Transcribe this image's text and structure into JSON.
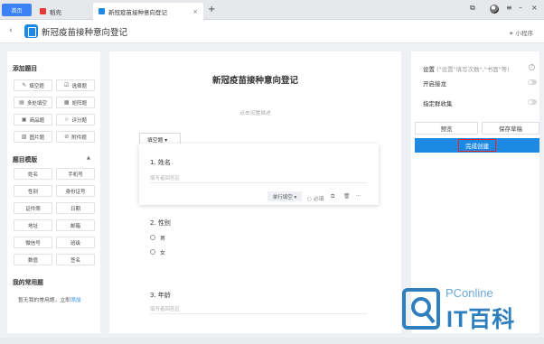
{
  "browser": {
    "tabs": [
      {
        "label": "首页"
      },
      {
        "label": "稻壳"
      },
      {
        "label": "新冠疫苗接种意向登记"
      }
    ]
  },
  "header": {
    "back": "‹",
    "title": "新冠疫苗接种意向登记",
    "mini_program": "小程序"
  },
  "left": {
    "add_title": "添加题目",
    "question_types": [
      {
        "icon": "✎",
        "label": "填空题"
      },
      {
        "icon": "☑",
        "label": "选择题"
      },
      {
        "icon": "▤",
        "label": "多处填空"
      },
      {
        "icon": "▦",
        "label": "矩阵题"
      },
      {
        "icon": "▣",
        "label": "商品题"
      },
      {
        "icon": "☆",
        "label": "评分题"
      },
      {
        "icon": "▨",
        "label": "图片题"
      },
      {
        "icon": "⊘",
        "label": "附件题"
      }
    ],
    "template_title": "题目模版",
    "templates": [
      "姓名",
      "手机号",
      "性别",
      "身份证号",
      "证件照",
      "日期",
      "地址",
      "邮箱",
      "微信号",
      "班级",
      "数值",
      "签名"
    ],
    "common_title": "我的常用题",
    "common_hint": "暂无我的常用题，立即",
    "common_link": "添加"
  },
  "form": {
    "title": "新冠疫苗接种意向登记",
    "desc_placeholder": "点击设置描述",
    "type_tag": "填空题 ▾",
    "q1": {
      "label": "1. 姓名",
      "placeholder": "填写者回答区"
    },
    "q1_tools": {
      "select": "单行填空 ▾",
      "required": "必填",
      "more": "···"
    },
    "q2": {
      "label": "2. 性别",
      "options": [
        "男",
        "女"
      ]
    },
    "q3": {
      "label": "3. 年龄",
      "placeholder": "填写者回答区"
    }
  },
  "right": {
    "settings": "设置",
    "settings_hint": "(\"设置\"填写次数\",\"书面\"等)",
    "open_link": "开启接龙",
    "assign_collect": "指定群收集",
    "preview": "预览",
    "save_draft": "保存草稿",
    "finish": "完成创建"
  },
  "watermark": {
    "brand": "PConline",
    "name": "IT百科"
  },
  "colors": {
    "accent": "#1e88e5",
    "home_tab": "#3b82f6",
    "highlight_border": "#e02424"
  }
}
